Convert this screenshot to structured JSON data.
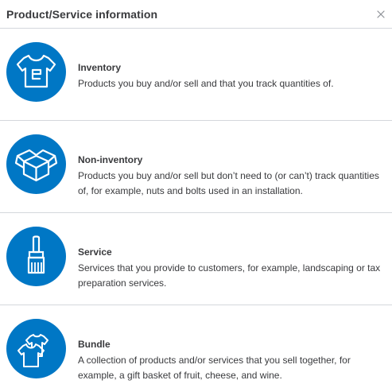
{
  "header": {
    "title": "Product/Service information",
    "close_icon": "close-icon"
  },
  "colors": {
    "accent": "#0077c5",
    "text": "#393a3d",
    "divider": "#d4d7dc"
  },
  "items": [
    {
      "name": "Inventory",
      "description": "Products you buy and/or sell and that you track quantities of.",
      "icon": "tshirt-icon"
    },
    {
      "name": "Non-inventory",
      "description": "Products you buy and/or sell but don’t need to (or can’t) track quantities of, for example, nuts and bolts used in an installation.",
      "icon": "open-box-icon"
    },
    {
      "name": "Service",
      "description": "Services that you provide to customers, for example, landscaping or tax preparation services.",
      "icon": "paintbrush-icon"
    },
    {
      "name": "Bundle",
      "description": "A collection of products and/or services that you sell together, for example, a gift basket of fruit, cheese, and wine.",
      "icon": "bundle-shirts-icon"
    }
  ]
}
